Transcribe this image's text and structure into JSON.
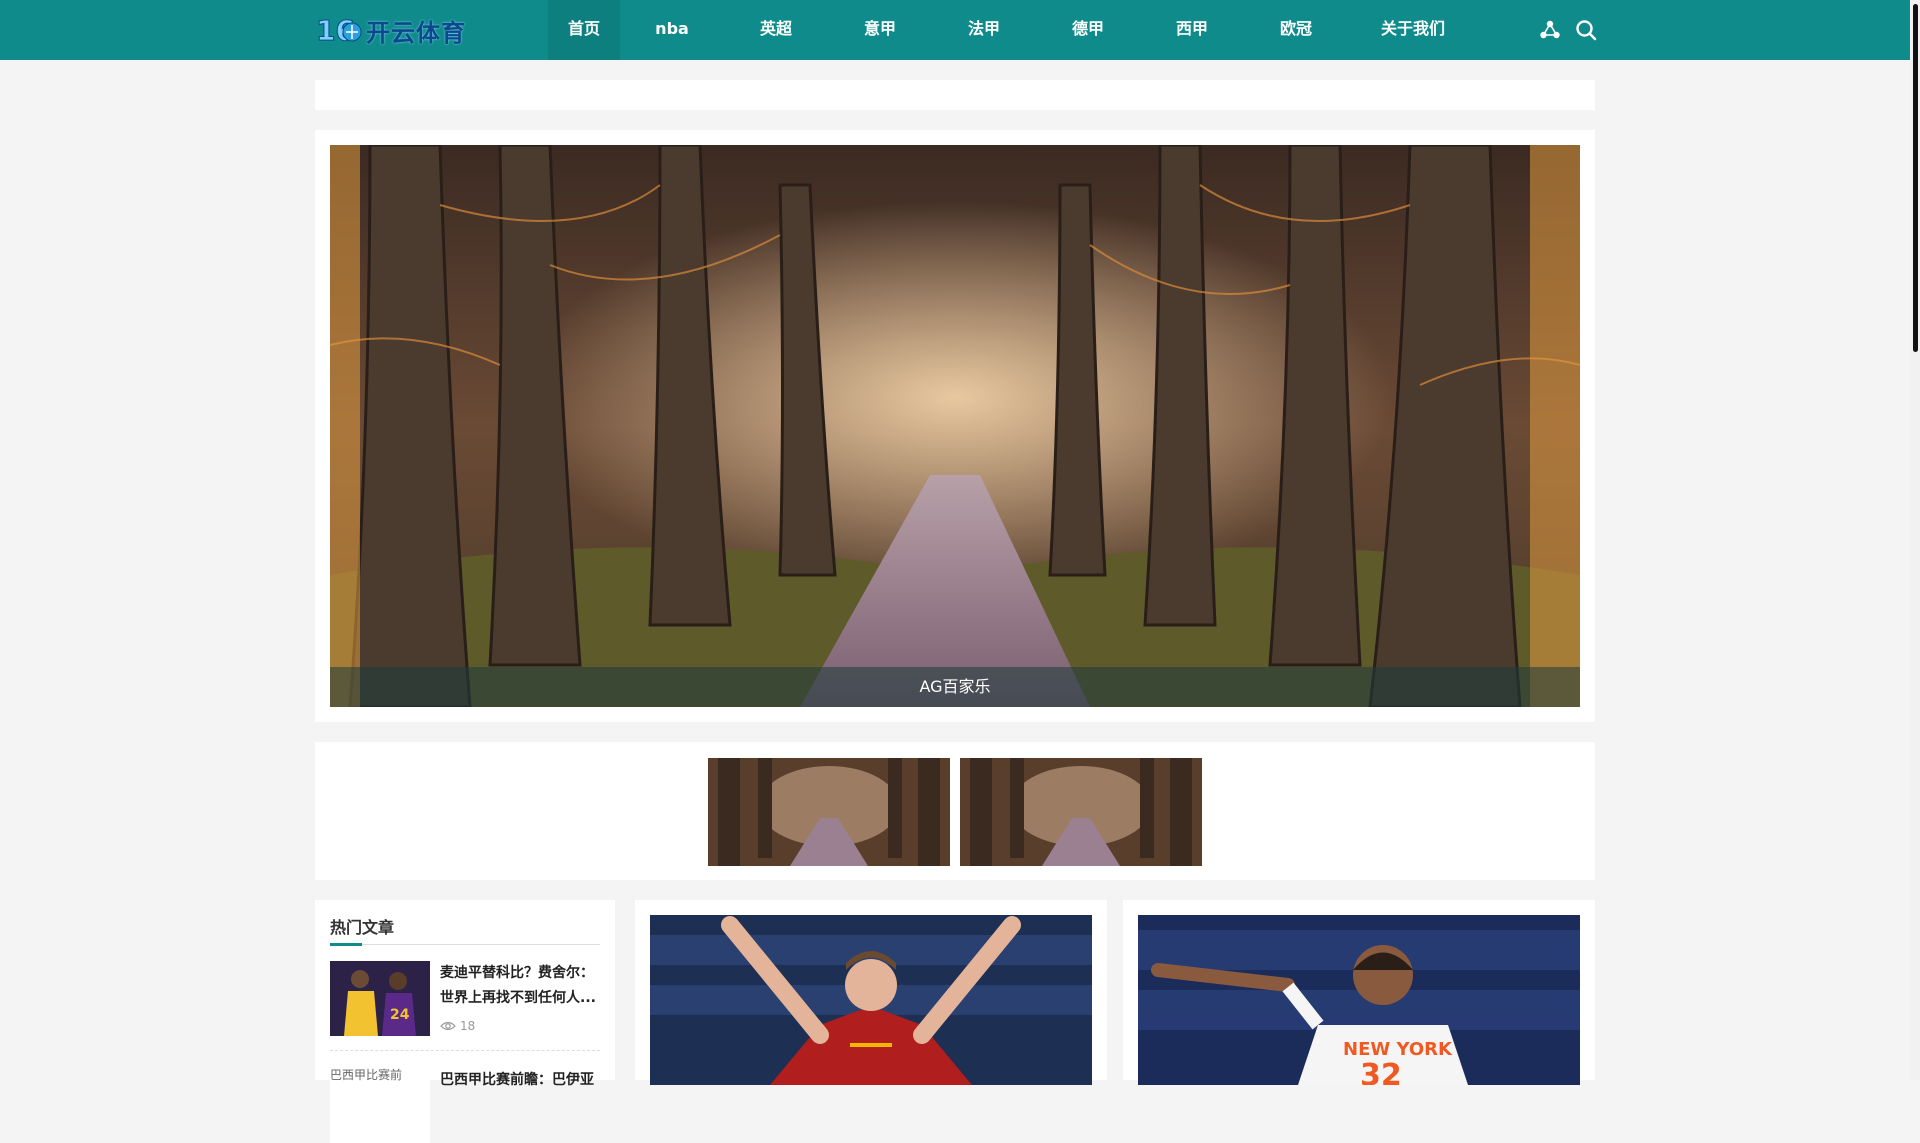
{
  "colors": {
    "brand": "#0f8b8b",
    "brand_dark": "#0d7f7f",
    "logo_text": "#0a4a8a"
  },
  "header": {
    "logo_text": "开云体育",
    "nav": [
      {
        "label": "首页",
        "active": true
      },
      {
        "label": "nba",
        "active": false
      },
      {
        "label": "英超",
        "active": false
      },
      {
        "label": "意甲",
        "active": false
      },
      {
        "label": "法甲",
        "active": false
      },
      {
        "label": "德甲",
        "active": false
      },
      {
        "label": "西甲",
        "active": false
      },
      {
        "label": "欧冠",
        "active": false
      },
      {
        "label": "关于我们",
        "active": false
      }
    ],
    "icons": [
      "share-icon",
      "search-icon"
    ]
  },
  "banner": {
    "caption": "AG百家乐"
  },
  "thumbnails": {
    "count": 2
  },
  "hot_articles": {
    "title": "热门文章",
    "items": [
      {
        "title": "麦迪平替科比？费舍尔：世界上再找不到任何人...",
        "views": "18"
      },
      {
        "title": "巴西甲比赛前瞻：巴伊亚",
        "image_alt": "巴西甲比赛前"
      }
    ]
  },
  "cards": [
    {
      "name": "player-roma-celebration"
    },
    {
      "name": "player-knicks-32"
    }
  ]
}
